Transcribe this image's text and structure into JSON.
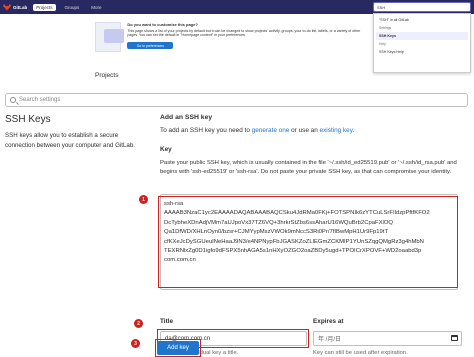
{
  "nav": {
    "brand": "GitLab",
    "items": [
      "Projects",
      "Groups",
      "More"
    ],
    "search_value": "SSH"
  },
  "dropdown": {
    "top_hint": "\"SSH\" in all GitLab",
    "settings_head": "Settings",
    "settings_item": "SSH Keys",
    "help_head": "Help",
    "help_item": "SSH Keys Help"
  },
  "banner": {
    "title": "Do you want to customize this page?",
    "text": "This page shows a list of your projects by default but it can be changed to show projects' activity, groups, your to-do list, labels, or a variety of other pages. You can set the default in \"Homepage content\" in your preferences",
    "button": "Go to preferences"
  },
  "projects_heading": "Projects",
  "settings_search_placeholder": "Search settings",
  "sidebar": {
    "title": "SSH Keys",
    "description": "SSH keys allow you to establish a secure connection between your computer and GitLab."
  },
  "main": {
    "section_title": "Add an SSH key",
    "intro_prefix": "To add an SSH key you need to ",
    "intro_link1": "generate one",
    "intro_mid": " or use an ",
    "intro_link2": "existing key",
    "intro_suffix": ".",
    "key_label": "Key",
    "key_help": "Paste your public SSH key, which is usually contained in the file '~/.ssh/id_ed25519.pub' or '~/.ssh/id_rsa.pub' and begins with 'ssh-ed25519' or 'ssh-rsa'. Do not paste your private SSH key, as that can compromise your identity.",
    "key_value": "ssh-rsa\nAAAAB3NzaC1yc2EAAAADAQABAAABAQCSku4JdRMa0FKj+FOTSPNIk6zYTCuLSrFIldzpPftfKFO2\nDcTybheXDnAdjVMm7aUJpoVx37TZ6VQ+3hrkrStZbs6ssAharU16WQuBrb2CpaFXlOQ\nQa1DfWD/XHLnOyn0/bzsr+CJMYypMszVWOk9mNccS3Ri0Pr/7fIBwMpH1Ur9Fp19tT\ncfKXeJcDySGUeuINeHaaJ9N3/e4NPNypFbJGASKZoZLlEGmZCKMIP1YUnSZqgQMgRz3g4hMbN\nTEXRNlxZg0D1igfo9dFSPX5nhAGA5s1nHXyOZGO2oaZBDy5ugd+TPOICrXPOVF+WD2oaabd3p\ncom.com.cn"
  },
  "title_field": {
    "label": "Title",
    "value": "da@com.com.cn",
    "help": "Give your individual key a title."
  },
  "expires_field": {
    "label": "Expires at",
    "value": "年 /月/日",
    "help": "Key can still be used after expiration."
  },
  "add_button": "Add key",
  "markers": [
    "1",
    "2",
    "3"
  ],
  "colors": {
    "nav_bg": "#292961",
    "primary": "#1f75cb",
    "annotation_red": "#d01f1f"
  }
}
